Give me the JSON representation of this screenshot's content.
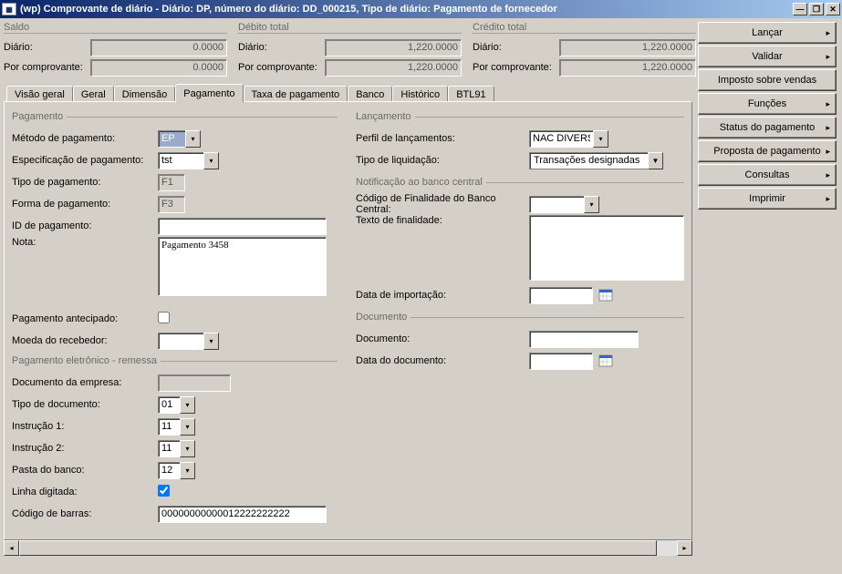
{
  "window": {
    "title": "(wp) Comprovante de diário - Diário: DP, número do diário: DD_000215, Tipo de diário: Pagamento de fornecedor"
  },
  "summary": {
    "saldo": {
      "label": "Saldo",
      "diario_lbl": "Diário:",
      "diario": "0.0000",
      "comprov_lbl": "Por comprovante:",
      "comprov": "0.0000"
    },
    "debito": {
      "label": "Débito total",
      "diario_lbl": "Diário:",
      "diario": "1,220.0000",
      "comprov_lbl": "Por comprovante:",
      "comprov": "1,220.0000"
    },
    "credito": {
      "label": "Crédito total",
      "diario_lbl": "Diário:",
      "diario": "1,220.0000",
      "comprov_lbl": "Por comprovante:",
      "comprov": "1,220.0000"
    }
  },
  "tabs": [
    "Visão geral",
    "Geral",
    "Dimensão",
    "Pagamento",
    "Taxa de pagamento",
    "Banco",
    "Histórico",
    "BTL91"
  ],
  "sections": {
    "pagamento": "Pagamento",
    "remessa": "Pagamento eletrônico - remessa",
    "lancamento": "Lançamento",
    "notificacao": "Notificação ao banco central",
    "documento": "Documento"
  },
  "fields": {
    "metodo_lbl": "Método de pagamento:",
    "metodo": "EP",
    "espec_lbl": "Especificação de pagamento:",
    "espec": "tst",
    "tipo_pag_lbl": "Tipo de pagamento:",
    "tipo_pag": "F1",
    "forma_lbl": "Forma de pagamento:",
    "forma": "F3",
    "id_lbl": "ID de pagamento:",
    "id": "",
    "nota_lbl": "Nota:",
    "nota": "Pagamento 3458",
    "antecipado_lbl": "Pagamento antecipado:",
    "moeda_lbl": "Moeda do recebedor:",
    "moeda": "",
    "doc_emp_lbl": "Documento da empresa:",
    "doc_emp": "",
    "tipo_doc_lbl": "Tipo de documento:",
    "tipo_doc": "01",
    "inst1_lbl": "Instrução 1:",
    "inst1": "11",
    "inst2_lbl": "Instrução 2:",
    "inst2": "11",
    "pasta_lbl": "Pasta do banco:",
    "pasta": "12",
    "linha_lbl": "Linha digitada:",
    "barras_lbl": "Código de barras:",
    "barras": "00000000000012222222222",
    "perfil_lbl": "Perfil de lançamentos:",
    "perfil": "NAC DIVERS",
    "liquid_lbl": "Tipo de liquidação:",
    "liquid": "Transações designadas",
    "bc_cod_lbl": "Código de Finalidade do Banco Central:",
    "bc_cod": "",
    "bc_txt_lbl": "Texto de finalidade:",
    "bc_txt": "",
    "import_lbl": "Data de importação:",
    "import": "",
    "doc_lbl": "Documento:",
    "doc": "",
    "doc_data_lbl": "Data do documento:",
    "doc_data": ""
  },
  "actions": {
    "lancar": "Lançar",
    "validar": "Validar",
    "imposto": "Imposto sobre vendas",
    "funcoes": "Funções",
    "status": "Status do pagamento",
    "proposta": "Proposta de pagamento",
    "consultas": "Consultas",
    "imprimir": "Imprimir"
  }
}
